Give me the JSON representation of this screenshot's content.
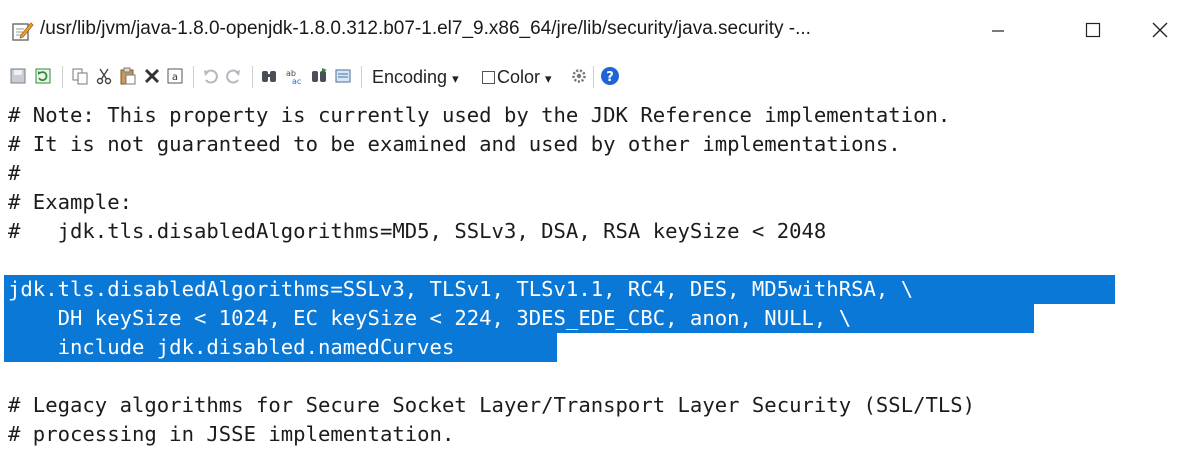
{
  "window": {
    "title": "/usr/lib/jvm/java-1.8.0-openjdk-1.8.0.312.b07-1.el7_9.x86_64/jre/lib/security/java.security -...",
    "app_icon": "notepad-edit-icon",
    "minimize_icon": "minimize-icon",
    "maximize_icon": "maximize-icon",
    "close_icon": "close-icon"
  },
  "toolbar": {
    "icons": [
      "save-icon",
      "reload-icon",
      "copy-icon",
      "cut-icon",
      "paste-icon",
      "delete-icon",
      "select-all-icon",
      "undo-icon",
      "redo-icon",
      "find-icon",
      "replace-icon",
      "find-next-icon",
      "view-icon"
    ],
    "encoding_label": "Encoding",
    "color_label": "Color",
    "settings_icon": "gear-icon",
    "help_icon": "help-icon",
    "dropdown_glyph": "▾"
  },
  "editor": {
    "lines": [
      "# Note: This property is currently used by the JDK Reference implementation.",
      "# It is not guaranteed to be examined and used by other implementations.",
      "#",
      "# Example:",
      "#   jdk.tls.disabledAlgorithms=MD5, SSLv3, DSA, RSA keySize < 2048",
      "jdk.tls.disabledAlgorithms=SSLv3, TLSv1, TLSv1.1, RC4, DES, MD5withRSA, \\",
      "    DH keySize < 1024, EC keySize < 224, 3DES_EDE_CBC, anon, NULL, \\",
      "    include jdk.disabled.namedCurves",
      "",
      "# Legacy algorithms for Secure Socket Layer/Transport Layer Security (SSL/TLS)",
      "# processing in JSSE implementation."
    ],
    "selection_color": "#0a78d7"
  }
}
